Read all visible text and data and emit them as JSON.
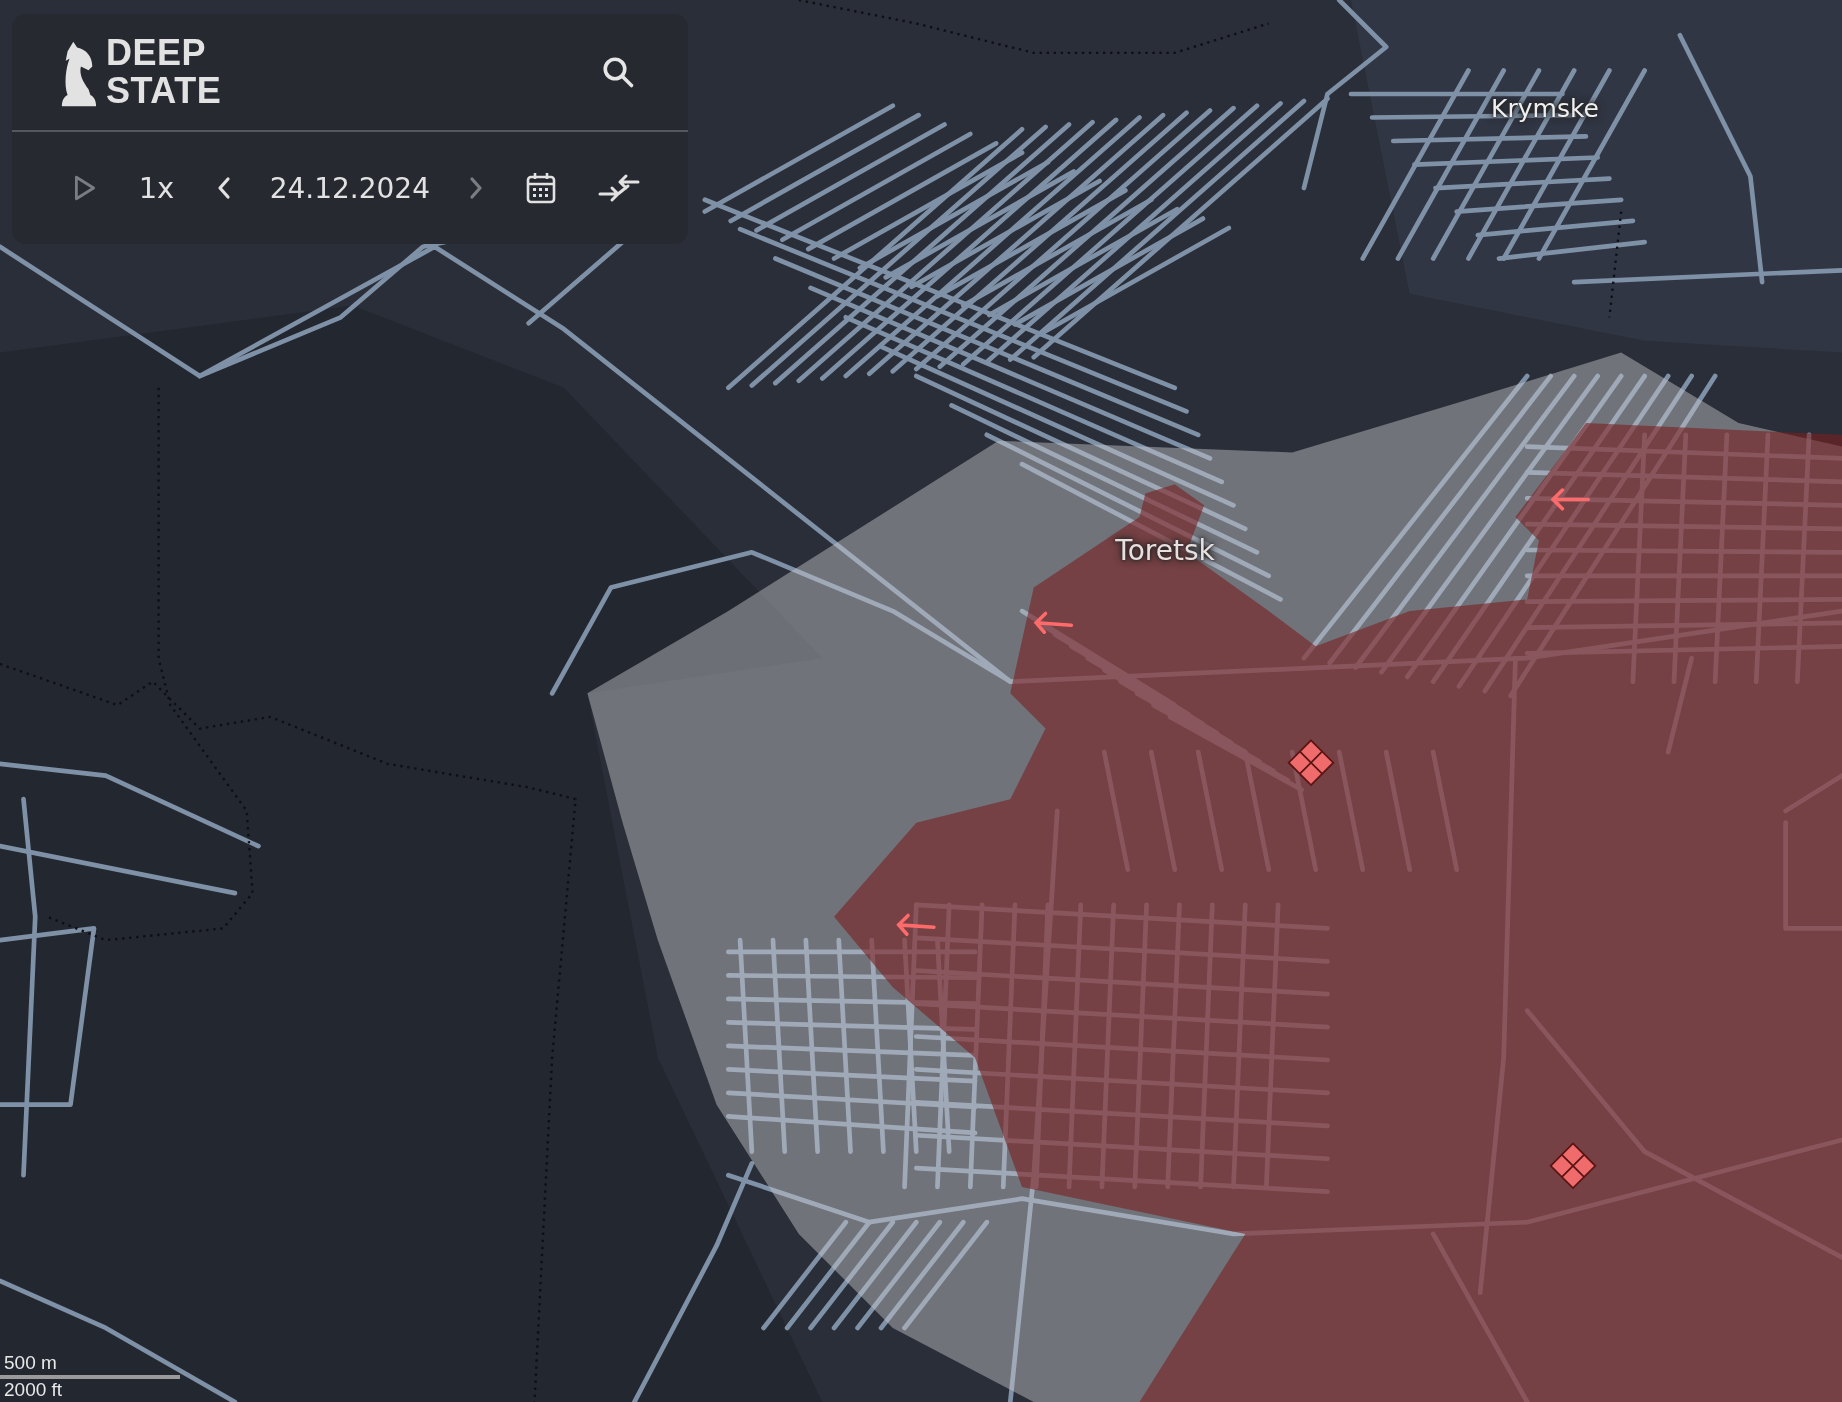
{
  "panel": {
    "logo": [
      "DEEP",
      "STATE"
    ],
    "timeline": {
      "play": {
        "disabled": true
      },
      "speed": "1x",
      "previous": {
        "disabled": false
      },
      "date": "24.12.2024",
      "next": {
        "disabled": true
      }
    }
  },
  "map": {
    "places": [
      {
        "name": "Krymske",
        "kind": "village"
      },
      {
        "name": "Toretsk",
        "kind": "town"
      }
    ],
    "scale": {
      "metric": "500 m",
      "imperial": "2000 ft"
    }
  }
}
